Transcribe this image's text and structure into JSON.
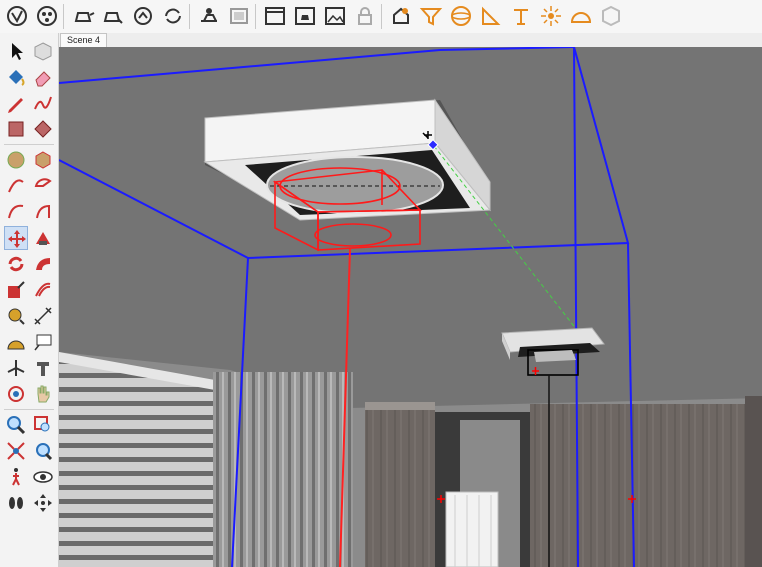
{
  "toolbar": {
    "groups": [
      [
        "styles-icon",
        "components-icon"
      ],
      [
        "teapot-icon",
        "warehouse-icon",
        "share-icon",
        "update-icon"
      ],
      [
        "solar-icon",
        "layout-icon"
      ],
      [
        "window-icon",
        "window-model-icon",
        "window-photo-icon",
        "lock-icon"
      ],
      [
        "house-settings-icon",
        "funnel-icon",
        "sphere-icon",
        "triangle-ruler-icon",
        "lamp-icon",
        "sun-icon",
        "dome-icon",
        "cube-icon"
      ]
    ]
  },
  "tabs": {
    "scene_tab": "Scene 4"
  },
  "sidebar": {
    "tools": [
      "select-tool-icon",
      "component-tool-icon",
      "paint-bucket-icon",
      "eraser-icon",
      "pencil-icon",
      "freehand-icon",
      "rectangle-icon",
      "rotated-rectangle-icon",
      "circle-icon",
      "polygon-icon",
      "arc-icon",
      "pie-icon",
      "arc-3pt-icon",
      "arc-2pt-icon",
      "move-icon",
      "push-pull-icon",
      "rotate-icon",
      "follow-me-icon",
      "scale-icon",
      "offset-icon",
      "tape-measure-icon",
      "dimension-icon",
      "protractor-icon",
      "text-icon",
      "axes-icon",
      "3d-text-icon",
      "orbit-icon",
      "pan-icon",
      "zoom-icon",
      "zoom-window-icon",
      "zoom-extents-icon",
      "previous-view-icon",
      "walk-icon",
      "look-around-icon",
      "footprint-icon",
      "section-plane-icon"
    ],
    "active_tool": "move-icon"
  },
  "colors": {
    "ceiling": "#737373",
    "wall": "#8a8a8a",
    "bounding_box": "#1b1bff",
    "selection": "#ff0000",
    "inference": "#33cc33"
  }
}
